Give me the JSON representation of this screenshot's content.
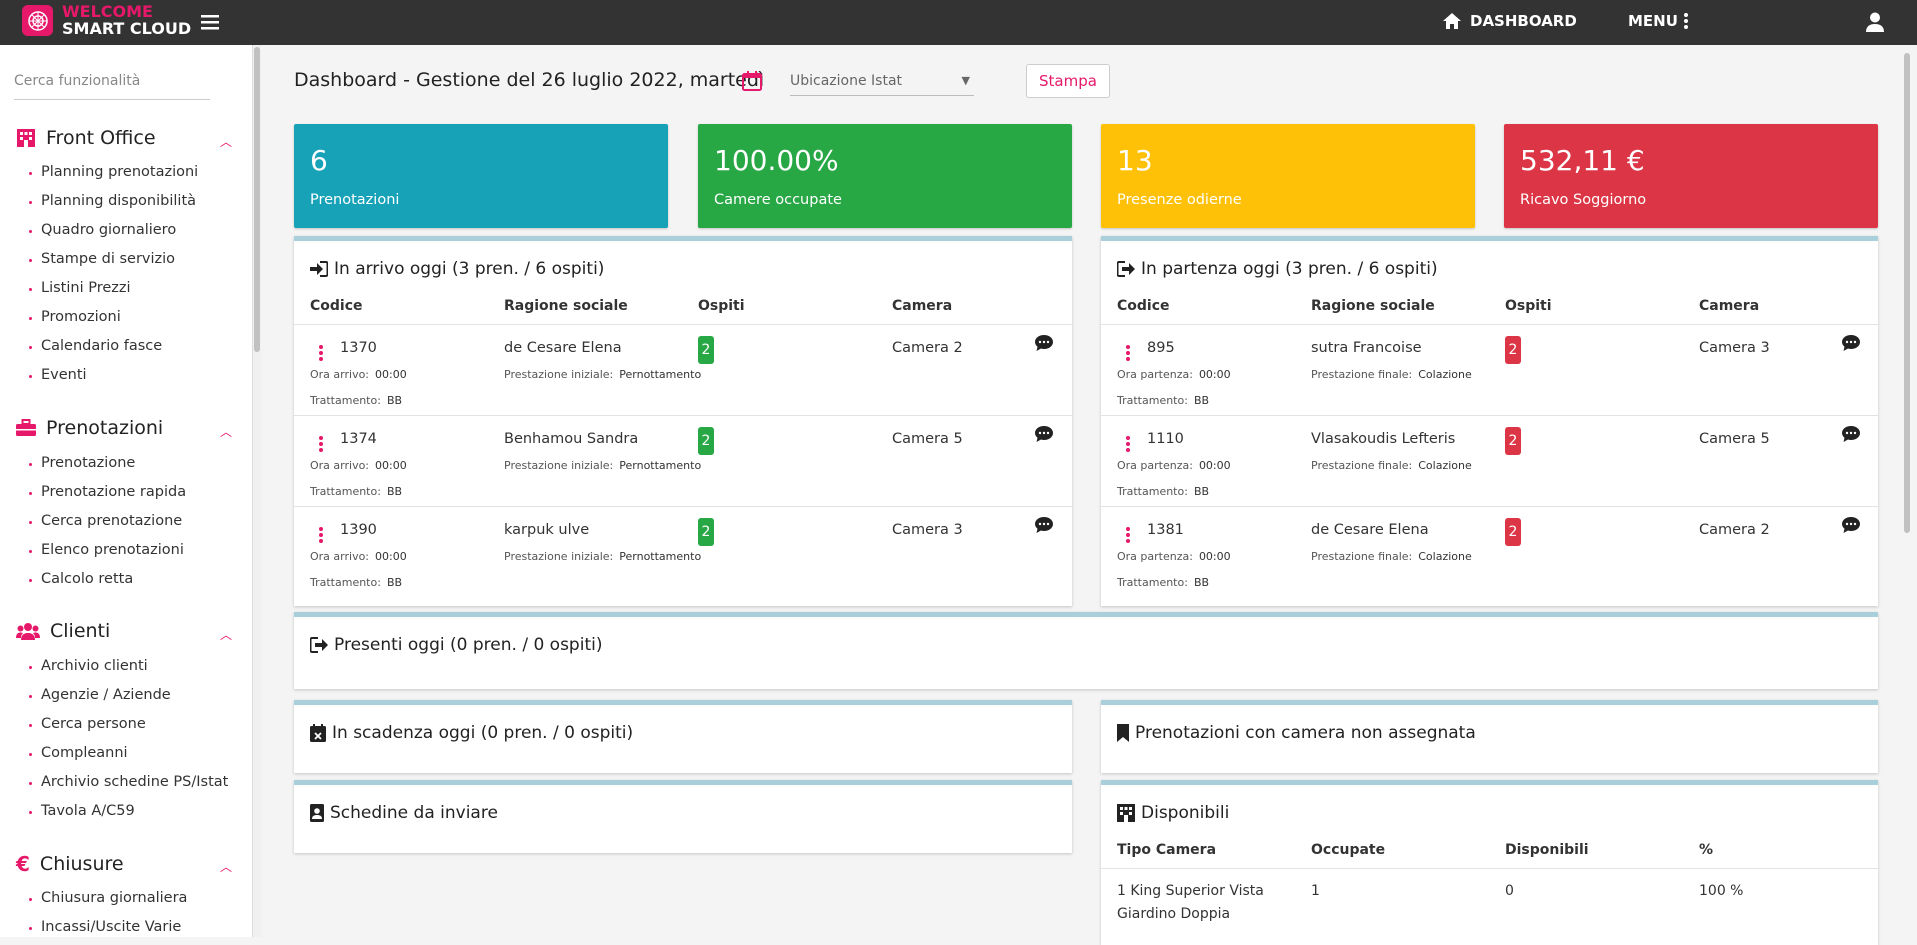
{
  "brand": {
    "line1": "WELCOME",
    "line2": "SMART CLOUD"
  },
  "nav": {
    "dashboard": "DASHBOARD",
    "menu": "MENU"
  },
  "sidebar": {
    "search_placeholder": "Cerca funzionalità",
    "sections": [
      {
        "title": "Front Office",
        "items": [
          "Planning prenotazioni",
          "Planning disponibilità",
          "Quadro giornaliero",
          "Stampe di servizio",
          "Listini Prezzi",
          "Promozioni",
          "Calendario fasce",
          "Eventi"
        ]
      },
      {
        "title": "Prenotazioni",
        "items": [
          "Prenotazione",
          "Prenotazione rapida",
          "Cerca prenotazione",
          "Elenco prenotazioni",
          "Calcolo retta"
        ]
      },
      {
        "title": "Clienti",
        "items": [
          "Archivio clienti",
          "Agenzie / Aziende",
          "Cerca persone",
          "Compleanni",
          "Archivio schedine PS/Istat",
          "Tavola A/C59"
        ]
      },
      {
        "title": "Chiusure",
        "items": [
          "Chiusura giornaliera",
          "Incassi/Uscite Varie"
        ]
      }
    ]
  },
  "header": {
    "title": "Dashboard - Gestione del 26 luglio 2022, martedì",
    "select_placeholder": "Ubicazione Istat",
    "print_label": "Stampa"
  },
  "stats": [
    {
      "value": "6",
      "label": "Prenotazioni",
      "color": "#17a2b8"
    },
    {
      "value": "100.00%",
      "label": "Camere occupate",
      "color": "#28a745"
    },
    {
      "value": "13",
      "label": "Presenze odierne",
      "color": "#ffc107"
    },
    {
      "value": "532,11 €",
      "label": "Ricavo Soggiorno",
      "color": "#dc3545"
    }
  ],
  "arrivals": {
    "title": "In arrivo oggi (3 pren. / 6 ospiti)",
    "headers": [
      "Codice",
      "Ragione sociale",
      "Ospiti",
      "Camera"
    ],
    "time_label": "Ora arrivo:",
    "treat_label": "Trattamento:",
    "serv_label": "Prestazione iniziale:",
    "rows": [
      {
        "code": "1370",
        "name": "de Cesare Elena",
        "guests": "2",
        "room": "Camera 2",
        "time": "00:00",
        "treat": "BB",
        "serv": "Pernottamento"
      },
      {
        "code": "1374",
        "name": "Benhamou Sandra",
        "guests": "2",
        "room": "Camera 5",
        "time": "00:00",
        "treat": "BB",
        "serv": "Pernottamento"
      },
      {
        "code": "1390",
        "name": "karpuk ulve",
        "guests": "2",
        "room": "Camera 3",
        "time": "00:00",
        "treat": "BB",
        "serv": "Pernottamento"
      }
    ]
  },
  "departures": {
    "title": "In partenza oggi (3 pren. / 6 ospiti)",
    "headers": [
      "Codice",
      "Ragione sociale",
      "Ospiti",
      "Camera"
    ],
    "time_label": "Ora partenza:",
    "treat_label": "Trattamento:",
    "serv_label": "Prestazione finale:",
    "rows": [
      {
        "code": "895",
        "name": "sutra Francoise",
        "guests": "2",
        "room": "Camera 3",
        "time": "00:00",
        "treat": "BB",
        "serv": "Colazione"
      },
      {
        "code": "1110",
        "name": "Vlasakoudis Lefteris",
        "guests": "2",
        "room": "Camera 5",
        "time": "00:00",
        "treat": "BB",
        "serv": "Colazione"
      },
      {
        "code": "1381",
        "name": "de Cesare Elena",
        "guests": "2",
        "room": "Camera 2",
        "time": "00:00",
        "treat": "BB",
        "serv": "Colazione"
      }
    ]
  },
  "present": {
    "title": "Presenti oggi (0 pren. / 0 ospiti)"
  },
  "expiring": {
    "title": "In scadenza oggi (0 pren. / 0 ospiti)"
  },
  "unassigned": {
    "title": "Prenotazioni con camera non assegnata"
  },
  "schedine": {
    "title": "Schedine da inviare"
  },
  "available": {
    "title": "Disponibili",
    "headers": [
      "Tipo Camera",
      "Occupate",
      "Disponibili",
      "%"
    ],
    "rows": [
      {
        "type_line1": "1 King Superior Vista",
        "type_line2": "Giardino Doppia",
        "occupied": "1",
        "available": "0",
        "pct": "100 %"
      }
    ]
  },
  "colors": {
    "accent": "#e6186a",
    "green": "#28a745",
    "red": "#dc3545"
  }
}
